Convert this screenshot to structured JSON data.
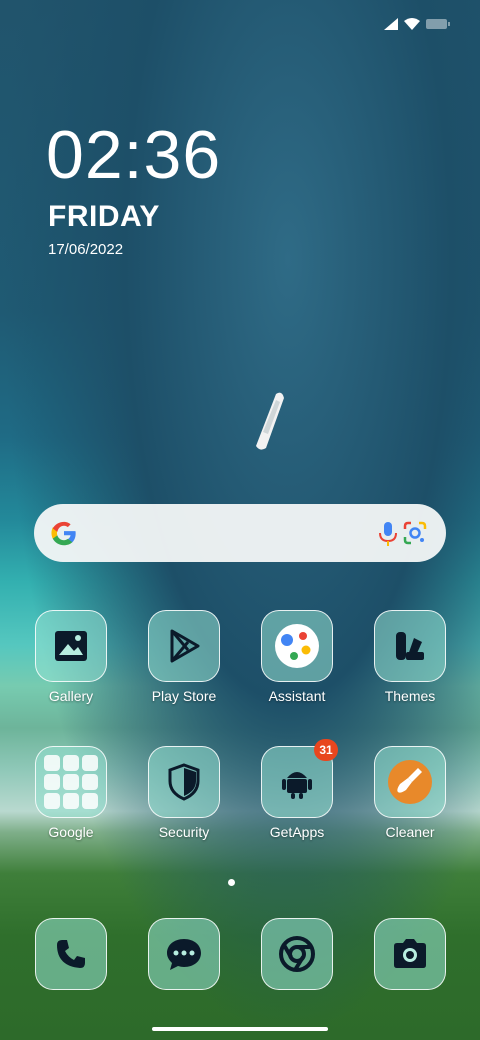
{
  "status": {
    "icons": [
      "signal-icon",
      "wifi-icon",
      "battery-icon"
    ]
  },
  "lockscreen": {
    "time": "02:36",
    "day": "FRIDAY",
    "date": "17/06/2022"
  },
  "search": {
    "icons": [
      "google-g-icon",
      "microphone-icon",
      "google-lens-icon"
    ]
  },
  "apps_row1": [
    {
      "label": "Gallery",
      "icon": "gallery-icon"
    },
    {
      "label": "Play Store",
      "icon": "play-store-icon"
    },
    {
      "label": "Assistant",
      "icon": "assistant-icon"
    },
    {
      "label": "Themes",
      "icon": "themes-icon"
    }
  ],
  "apps_row2": [
    {
      "label": "Google",
      "icon": "folder-icon"
    },
    {
      "label": "Security",
      "icon": "shield-icon"
    },
    {
      "label": "GetApps",
      "icon": "android-icon",
      "badge": "31"
    },
    {
      "label": "Cleaner",
      "icon": "broom-icon"
    }
  ],
  "dock": [
    {
      "icon": "phone-icon"
    },
    {
      "icon": "messages-icon"
    },
    {
      "icon": "chrome-icon"
    },
    {
      "icon": "camera-icon"
    }
  ],
  "colors": {
    "badge": "#e8461e",
    "google_blue": "#4285F4",
    "google_red": "#EA4335",
    "google_yellow": "#FBBC05",
    "google_green": "#34A853"
  }
}
